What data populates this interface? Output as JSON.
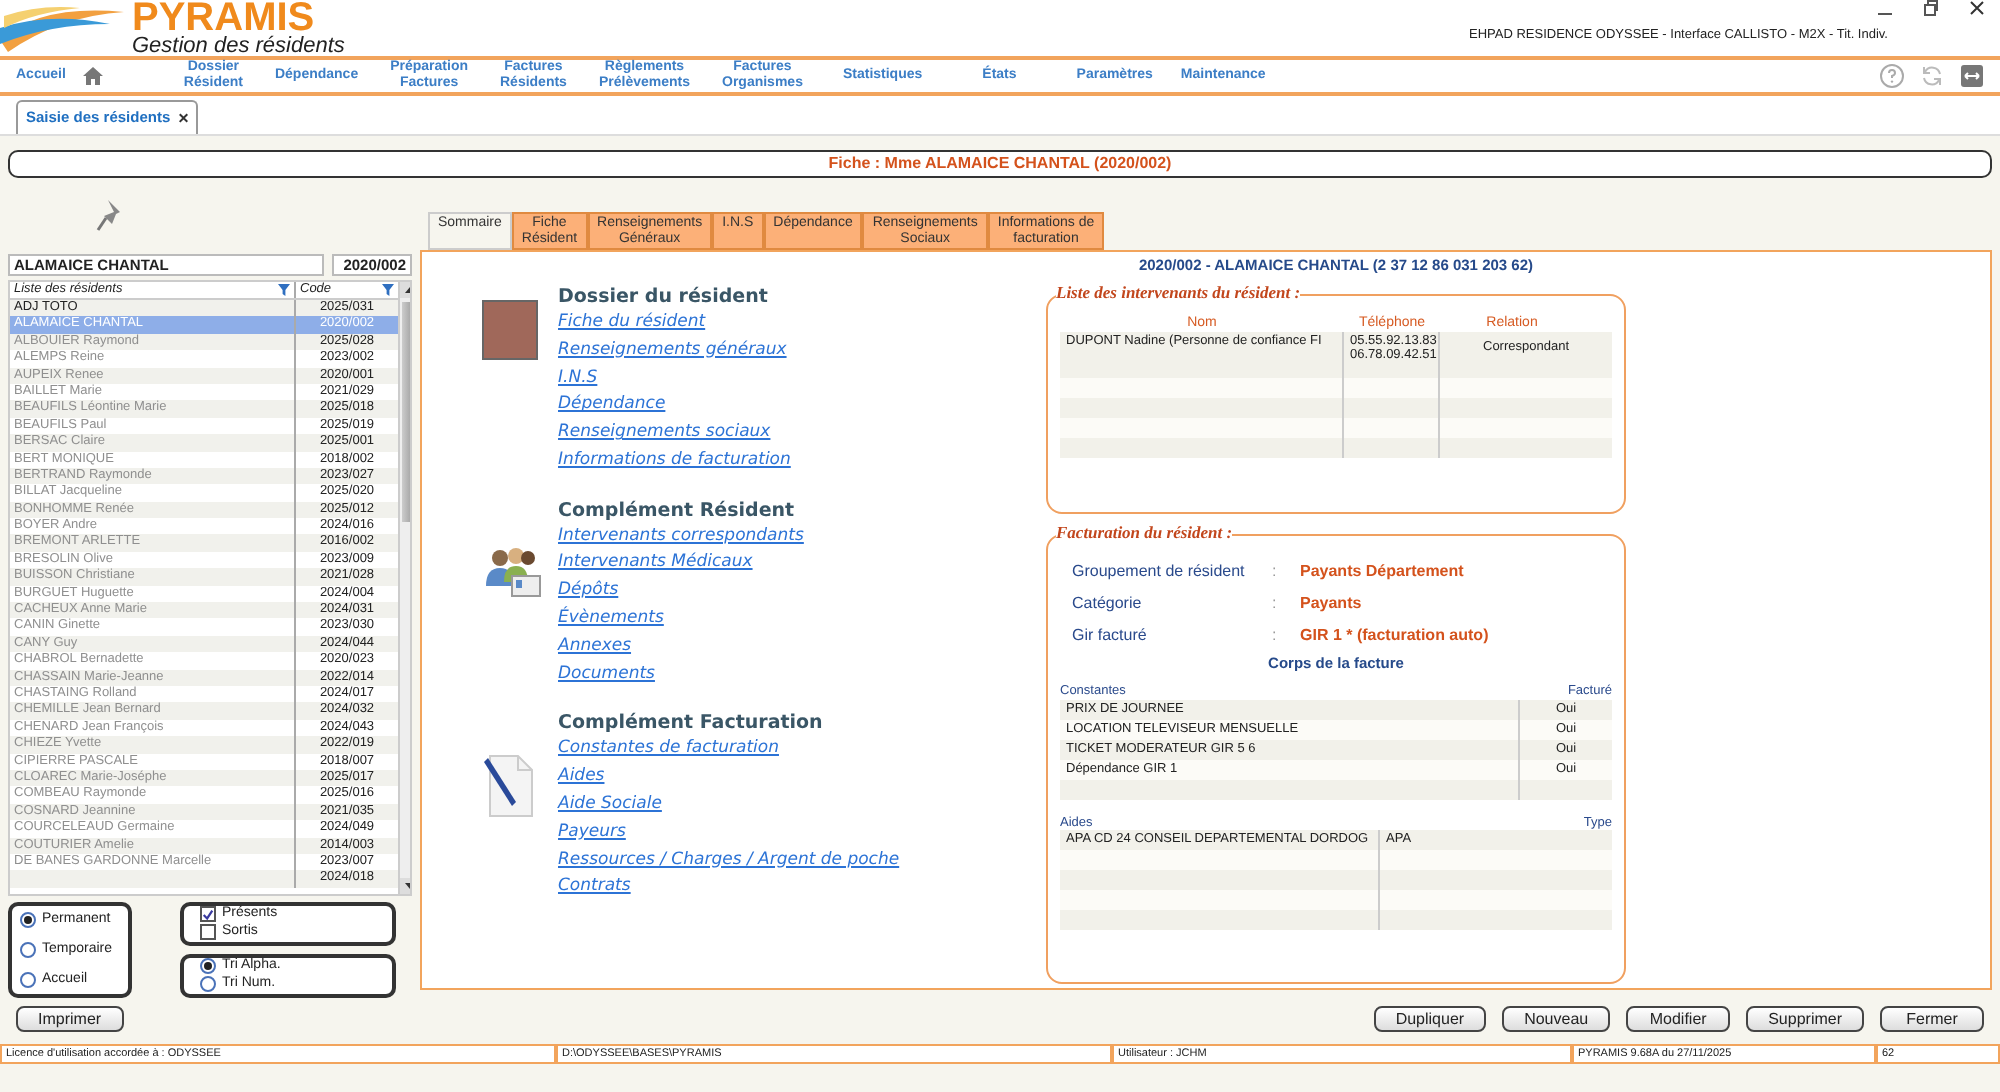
{
  "app": {
    "logo": "PYRAMIS",
    "subtitle": "Gestion des résidents",
    "title": "EHPAD RESIDENCE ODYSSEE  - Interface CALLISTO - M2X - Tit. Indiv."
  },
  "nav": [
    {
      "label": "Accueil",
      "kind": "home"
    },
    {
      "label": "Dossier\nRésident",
      "kind": "text"
    },
    {
      "label": "Dépendance",
      "kind": "text"
    },
    {
      "label": "Préparation\nFactures",
      "kind": "text"
    },
    {
      "label": "Factures\nRésidents",
      "kind": "text"
    },
    {
      "label": "Règlements\nPrélèvements",
      "kind": "text"
    },
    {
      "label": "Factures\nOrganismes",
      "kind": "text"
    },
    {
      "label": "Statistiques",
      "kind": "text"
    },
    {
      "label": "États",
      "kind": "text"
    },
    {
      "label": "Paramètres",
      "kind": "text"
    },
    {
      "label": "Maintenance",
      "kind": "text"
    }
  ],
  "window_tabs": [
    {
      "label": "Saisie des résidents",
      "selected": true,
      "close": "×"
    }
  ],
  "fiche_title": "Fiche : Mme ALAMAICE CHANTAL (2020/002)",
  "resident_list": {
    "current_name": "ALAMAICE CHANTAL",
    "current_code": "2020/002",
    "columns": [
      "Liste des résidents",
      "Code"
    ],
    "rows": [
      {
        "name": "ADJ TOTO",
        "code": "2025/031",
        "selected": false,
        "dimmed": false
      },
      {
        "name": "ALAMAICE CHANTAL",
        "code": "2020/002",
        "selected": true,
        "dimmed": false
      },
      {
        "name": "ALBOUIER Raymond",
        "code": "2025/028",
        "selected": false,
        "dimmed": true
      },
      {
        "name": "ALEMPS Reine",
        "code": "2023/002",
        "selected": false,
        "dimmed": true
      },
      {
        "name": "AUPEIX Renee",
        "code": "2020/001",
        "selected": false,
        "dimmed": true
      },
      {
        "name": "BAILLET Marie",
        "code": "2021/029",
        "selected": false,
        "dimmed": true
      },
      {
        "name": "BEAUFILS Léontine Marie",
        "code": "2025/018",
        "selected": false,
        "dimmed": true
      },
      {
        "name": "BEAUFILS Paul",
        "code": "2025/019",
        "selected": false,
        "dimmed": true
      },
      {
        "name": "BERSAC Claire",
        "code": "2025/001",
        "selected": false,
        "dimmed": true
      },
      {
        "name": "BERT MONIQUE",
        "code": "2018/002",
        "selected": false,
        "dimmed": true
      },
      {
        "name": "BERTRAND Raymonde",
        "code": "2023/027",
        "selected": false,
        "dimmed": true
      },
      {
        "name": "BILLAT Jacqueline",
        "code": "2025/020",
        "selected": false,
        "dimmed": true
      },
      {
        "name": "BONHOMME Renée",
        "code": "2025/012",
        "selected": false,
        "dimmed": true
      },
      {
        "name": "BOYER Andre",
        "code": "2024/016",
        "selected": false,
        "dimmed": true
      },
      {
        "name": "BREMONT ARLETTE",
        "code": "2016/002",
        "selected": false,
        "dimmed": true
      },
      {
        "name": "BRESOLIN Olive",
        "code": "2023/009",
        "selected": false,
        "dimmed": true
      },
      {
        "name": "BUISSON Christiane",
        "code": "2021/028",
        "selected": false,
        "dimmed": true
      },
      {
        "name": "BURGUET Huguette",
        "code": "2024/004",
        "selected": false,
        "dimmed": true
      },
      {
        "name": "CACHEUX Anne Marie",
        "code": "2024/031",
        "selected": false,
        "dimmed": true
      },
      {
        "name": "CANIN Ginette",
        "code": "2023/030",
        "selected": false,
        "dimmed": true
      },
      {
        "name": "CANY Guy",
        "code": "2024/044",
        "selected": false,
        "dimmed": true
      },
      {
        "name": "CHABROL Bernadette",
        "code": "2020/023",
        "selected": false,
        "dimmed": true
      },
      {
        "name": "CHASSAIN Marie-Jeanne",
        "code": "2022/014",
        "selected": false,
        "dimmed": true
      },
      {
        "name": "CHASTAING Rolland",
        "code": "2024/017",
        "selected": false,
        "dimmed": true
      },
      {
        "name": "CHEMILLE Jean Bernard",
        "code": "2024/032",
        "selected": false,
        "dimmed": true
      },
      {
        "name": "CHENARD Jean François",
        "code": "2024/043",
        "selected": false,
        "dimmed": true
      },
      {
        "name": "CHIEZE Yvette",
        "code": "2022/019",
        "selected": false,
        "dimmed": true
      },
      {
        "name": "CIPIERRE PASCALE",
        "code": "2018/007",
        "selected": false,
        "dimmed": true
      },
      {
        "name": "CLOAREC Marie-Joséphe",
        "code": "2025/017",
        "selected": false,
        "dimmed": true
      },
      {
        "name": "COMBEAU Raymonde",
        "code": "2025/016",
        "selected": false,
        "dimmed": true
      },
      {
        "name": "COSNARD Jeannine",
        "code": "2021/035",
        "selected": false,
        "dimmed": true
      },
      {
        "name": "COURCELEAUD Germaine",
        "code": "2024/049",
        "selected": false,
        "dimmed": true
      },
      {
        "name": "COUTURIER Amelie",
        "code": "2014/003",
        "selected": false,
        "dimmed": true
      },
      {
        "name": "DE BANES GARDONNE Marcelle",
        "code": "2023/007",
        "selected": false,
        "dimmed": true
      },
      {
        "code": "2024/018",
        "selected": false
      }
    ]
  },
  "stay_types": [
    {
      "label": "Permanent",
      "selected": true
    },
    {
      "label": "Temporaire",
      "selected": false
    },
    {
      "label": "Accueil",
      "selected": false
    }
  ],
  "presence": [
    {
      "label": "Présents",
      "checked": true
    },
    {
      "label": "Sortis",
      "checked": false
    }
  ],
  "sort": [
    {
      "label": "Tri Alpha.",
      "selected": true
    },
    {
      "label": "Tri Num.",
      "selected": false
    }
  ],
  "tabs": [
    {
      "label": "Sommaire",
      "selected": true
    },
    {
      "label": "Fiche\nRésident",
      "selected": false
    },
    {
      "label": "Renseignements\nGénéraux",
      "selected": false
    },
    {
      "label": "I.N.S",
      "selected": false
    },
    {
      "label": "Dépendance",
      "selected": false
    },
    {
      "label": "Renseignements\nSociaux",
      "selected": false
    },
    {
      "label": "Informations de\nfacturation",
      "selected": false
    }
  ],
  "sections": [
    {
      "title": "Dossier du résident",
      "kind": "photo",
      "links": [
        "Fiche du résident",
        "Renseignements généraux",
        "I.N.S",
        "Dépendance",
        "Renseignements sociaux",
        "Informations de facturation"
      ]
    },
    {
      "title": "Complément Résident",
      "kind": "people",
      "links": [
        "Intervenants correspondants",
        "Intervenants Médicaux",
        "Dépôts",
        "Évènements",
        "Annexes",
        "Documents"
      ]
    },
    {
      "title": "Complément Facturation",
      "kind": "document",
      "links": [
        "Constantes de facturation",
        "Aides",
        "Aide Sociale",
        "Payeurs",
        "Ressources / Charges / Argent de poche",
        "Contrats"
      ]
    }
  ],
  "resident_header": "2020/002 - ALAMAICE CHANTAL (2 37 12 86 031 203 62)",
  "intervenants": {
    "legend": "Liste des intervenants du résident :",
    "columns": [
      "Nom",
      "Téléphone",
      "Relation"
    ],
    "rows": [
      {
        "name": "DUPONT Nadine  (Personne de confiance FI",
        "phones": [
          "05.55.92.13.83",
          "06.78.09.42.51"
        ],
        "relation": "Correspondant"
      }
    ]
  },
  "facturation": {
    "legend": "Facturation du résident :",
    "fields": [
      {
        "label": "Groupement de résident",
        "separator": ":",
        "value": "Payants Département"
      },
      {
        "label": "Catégorie",
        "separator": ":",
        "value": "Payants"
      },
      {
        "label": "Gir facturé",
        "separator": ":",
        "value": "GIR 1 * (facturation auto)"
      }
    ],
    "body_title": "Corps de la facture",
    "constantes": {
      "columns": [
        "Constantes",
        "Facturé"
      ],
      "rows": [
        [
          "PRIX DE JOURNEE",
          "Oui"
        ],
        [
          "LOCATION TELEVISEUR MENSUELLE",
          "Oui"
        ],
        [
          "TICKET MODERATEUR GIR 5 6",
          "Oui"
        ],
        [
          "Dépendance GIR 1",
          "Oui"
        ]
      ]
    },
    "aides": {
      "columns": [
        "Aides",
        "Type"
      ],
      "rows": [
        [
          "APA CD 24 CONSEIL DEPARTEMENTAL DORDOG",
          "APA"
        ]
      ]
    }
  },
  "left_buttons": [
    "Imprimer"
  ],
  "right_buttons": [
    "Dupliquer",
    "Nouveau",
    "Modifier",
    "Supprimer",
    "Fermer"
  ],
  "status_bar": [
    "Licence d'utilisation accordée à : ODYSSEE",
    "D:\\ODYSSEE\\BASES\\PYRAMIS",
    "Utilisateur : JCHM",
    "PYRAMIS 9.68A du 27/11/2025",
    "62"
  ]
}
